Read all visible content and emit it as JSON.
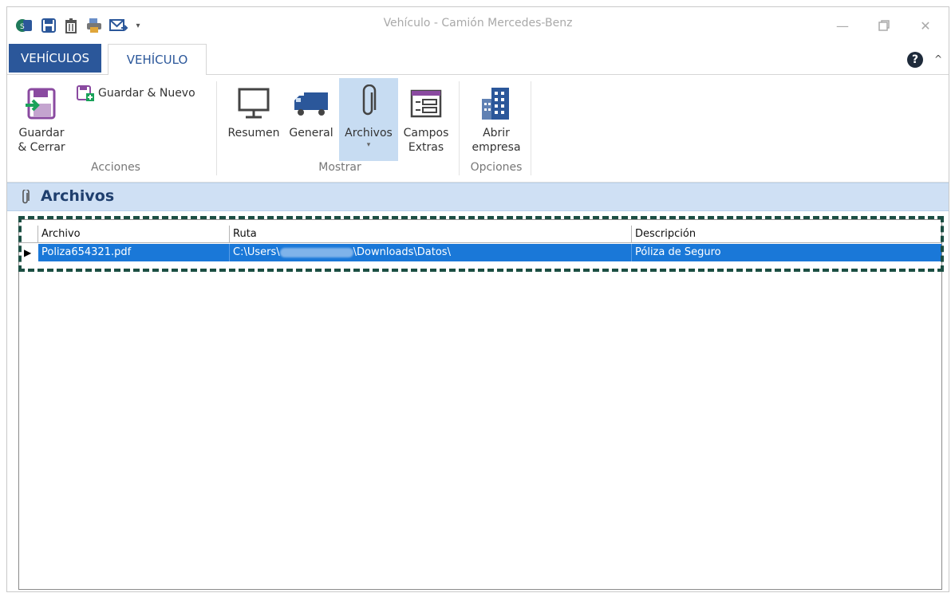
{
  "window": {
    "title": "Vehículo - Camión Mercedes-Benz"
  },
  "tabs": [
    {
      "label": "VEHÍCULOS"
    },
    {
      "label": "VEHÍCULO"
    }
  ],
  "ribbon": {
    "save_close": {
      "line1": "Guardar",
      "line2": "& Cerrar"
    },
    "save_new": "Guardar & Nuevo",
    "group_acciones": "Acciones",
    "resumen": "Resumen",
    "general": "General",
    "archivos": "Archivos",
    "campos": {
      "line1": "Campos",
      "line2": "Extras"
    },
    "group_mostrar": "Mostrar",
    "abrir": {
      "line1": "Abrir",
      "line2": "empresa"
    },
    "group_opciones": "Opciones"
  },
  "section": {
    "title": "Archivos"
  },
  "grid": {
    "columns": [
      "Archivo",
      "Ruta",
      "Descripción"
    ],
    "rows": [
      {
        "archivo": "Poliza654321.pdf",
        "ruta": "C:\\Users\\",
        "ruta_suffix": "\\Downloads\\Datos\\",
        "descripcion": "Póliza de Seguro"
      }
    ]
  },
  "colors": {
    "accent": "#2b579a",
    "selection": "#1a78d8",
    "highlight_border": "#1c4f43"
  }
}
